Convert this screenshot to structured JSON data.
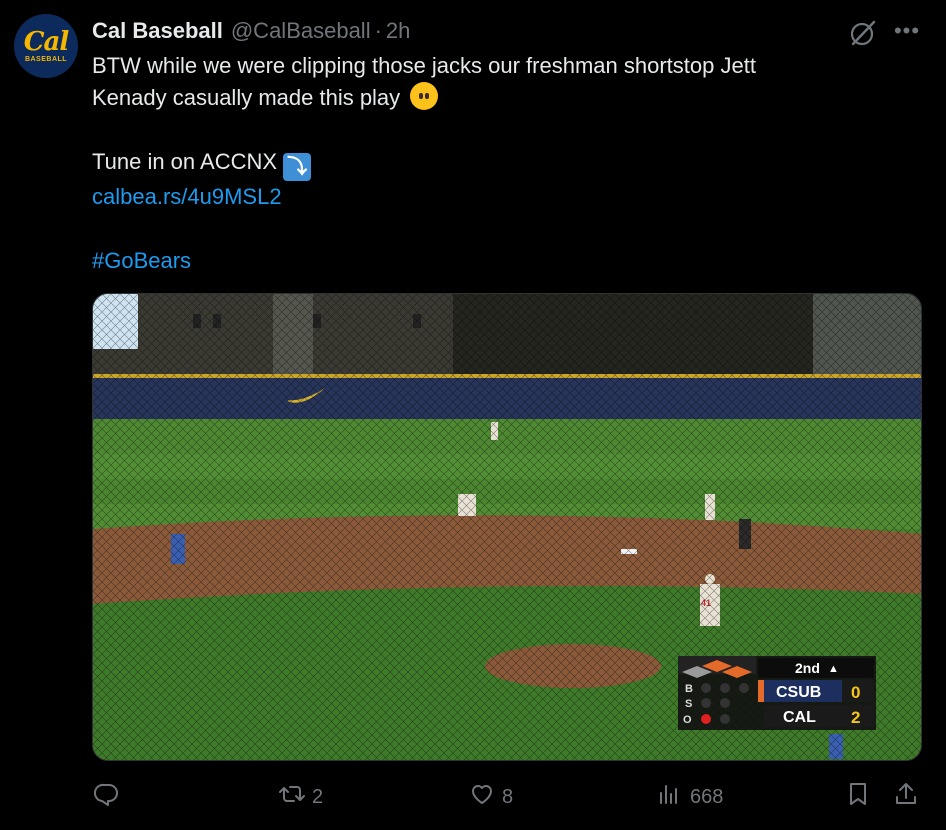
{
  "tweet": {
    "author_name": "Cal Baseball",
    "handle": "@CalBaseball",
    "separator": "·",
    "time": "2h",
    "avatar_logo": "Cal",
    "avatar_sub": "BASEBALL",
    "text_line1": "BTW while we were clipping those jacks our freshman shortstop Jett",
    "text_line2": "Kenady casually made this play",
    "text_line3": "Tune in on ACCNX",
    "link": "calbea.rs/4u9MSL2",
    "hashtag": "#GoBears"
  },
  "icons": {
    "grok": "grok-icon",
    "more": "more-icon",
    "emoji1": "face-without-mouth-emoji",
    "emoji2": "right-arrow-curving-down-emoji"
  },
  "scoreboard": {
    "inning": "2nd",
    "inning_arrow": "▲",
    "team1": "CSUB",
    "score1": "0",
    "team2": "CAL",
    "score2": "2",
    "b_label": "B",
    "s_label": "S",
    "o_label": "O",
    "outs": 1
  },
  "media_overlay": {
    "player_number": "41"
  },
  "actions": {
    "reply_count": "",
    "retweet_count": "2",
    "like_count": "8",
    "views_count": "668"
  },
  "colors": {
    "background": "#000000",
    "text": "#e7e9ea",
    "muted": "#71767b",
    "link": "#1d9bf0",
    "cal_blue": "#0d2a5c",
    "cal_gold": "#f5b800"
  }
}
